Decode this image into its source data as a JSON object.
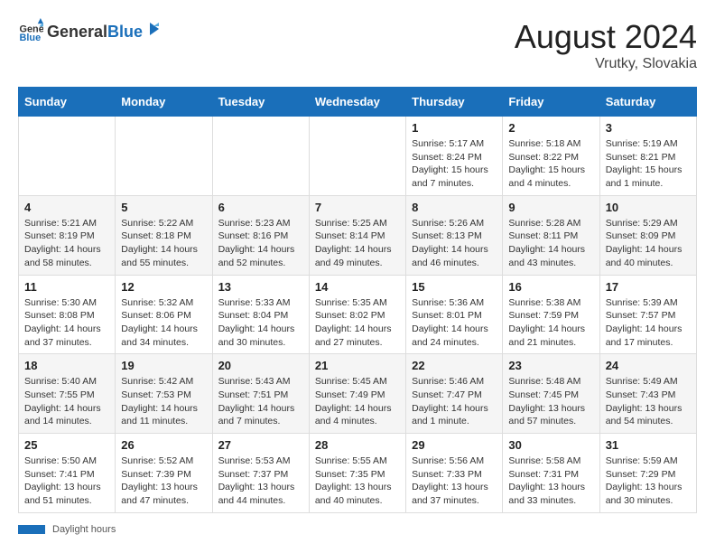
{
  "header": {
    "logo_general": "General",
    "logo_blue": "Blue",
    "month_year": "August 2024",
    "location": "Vrutky, Slovakia"
  },
  "footer": {
    "daylight_label": "Daylight hours"
  },
  "weekdays": [
    "Sunday",
    "Monday",
    "Tuesday",
    "Wednesday",
    "Thursday",
    "Friday",
    "Saturday"
  ],
  "weeks": [
    [
      {
        "day": "",
        "info": ""
      },
      {
        "day": "",
        "info": ""
      },
      {
        "day": "",
        "info": ""
      },
      {
        "day": "",
        "info": ""
      },
      {
        "day": "1",
        "info": "Sunrise: 5:17 AM\nSunset: 8:24 PM\nDaylight: 15 hours and 7 minutes."
      },
      {
        "day": "2",
        "info": "Sunrise: 5:18 AM\nSunset: 8:22 PM\nDaylight: 15 hours and 4 minutes."
      },
      {
        "day": "3",
        "info": "Sunrise: 5:19 AM\nSunset: 8:21 PM\nDaylight: 15 hours and 1 minute."
      }
    ],
    [
      {
        "day": "4",
        "info": "Sunrise: 5:21 AM\nSunset: 8:19 PM\nDaylight: 14 hours and 58 minutes."
      },
      {
        "day": "5",
        "info": "Sunrise: 5:22 AM\nSunset: 8:18 PM\nDaylight: 14 hours and 55 minutes."
      },
      {
        "day": "6",
        "info": "Sunrise: 5:23 AM\nSunset: 8:16 PM\nDaylight: 14 hours and 52 minutes."
      },
      {
        "day": "7",
        "info": "Sunrise: 5:25 AM\nSunset: 8:14 PM\nDaylight: 14 hours and 49 minutes."
      },
      {
        "day": "8",
        "info": "Sunrise: 5:26 AM\nSunset: 8:13 PM\nDaylight: 14 hours and 46 minutes."
      },
      {
        "day": "9",
        "info": "Sunrise: 5:28 AM\nSunset: 8:11 PM\nDaylight: 14 hours and 43 minutes."
      },
      {
        "day": "10",
        "info": "Sunrise: 5:29 AM\nSunset: 8:09 PM\nDaylight: 14 hours and 40 minutes."
      }
    ],
    [
      {
        "day": "11",
        "info": "Sunrise: 5:30 AM\nSunset: 8:08 PM\nDaylight: 14 hours and 37 minutes."
      },
      {
        "day": "12",
        "info": "Sunrise: 5:32 AM\nSunset: 8:06 PM\nDaylight: 14 hours and 34 minutes."
      },
      {
        "day": "13",
        "info": "Sunrise: 5:33 AM\nSunset: 8:04 PM\nDaylight: 14 hours and 30 minutes."
      },
      {
        "day": "14",
        "info": "Sunrise: 5:35 AM\nSunset: 8:02 PM\nDaylight: 14 hours and 27 minutes."
      },
      {
        "day": "15",
        "info": "Sunrise: 5:36 AM\nSunset: 8:01 PM\nDaylight: 14 hours and 24 minutes."
      },
      {
        "day": "16",
        "info": "Sunrise: 5:38 AM\nSunset: 7:59 PM\nDaylight: 14 hours and 21 minutes."
      },
      {
        "day": "17",
        "info": "Sunrise: 5:39 AM\nSunset: 7:57 PM\nDaylight: 14 hours and 17 minutes."
      }
    ],
    [
      {
        "day": "18",
        "info": "Sunrise: 5:40 AM\nSunset: 7:55 PM\nDaylight: 14 hours and 14 minutes."
      },
      {
        "day": "19",
        "info": "Sunrise: 5:42 AM\nSunset: 7:53 PM\nDaylight: 14 hours and 11 minutes."
      },
      {
        "day": "20",
        "info": "Sunrise: 5:43 AM\nSunset: 7:51 PM\nDaylight: 14 hours and 7 minutes."
      },
      {
        "day": "21",
        "info": "Sunrise: 5:45 AM\nSunset: 7:49 PM\nDaylight: 14 hours and 4 minutes."
      },
      {
        "day": "22",
        "info": "Sunrise: 5:46 AM\nSunset: 7:47 PM\nDaylight: 14 hours and 1 minute."
      },
      {
        "day": "23",
        "info": "Sunrise: 5:48 AM\nSunset: 7:45 PM\nDaylight: 13 hours and 57 minutes."
      },
      {
        "day": "24",
        "info": "Sunrise: 5:49 AM\nSunset: 7:43 PM\nDaylight: 13 hours and 54 minutes."
      }
    ],
    [
      {
        "day": "25",
        "info": "Sunrise: 5:50 AM\nSunset: 7:41 PM\nDaylight: 13 hours and 51 minutes."
      },
      {
        "day": "26",
        "info": "Sunrise: 5:52 AM\nSunset: 7:39 PM\nDaylight: 13 hours and 47 minutes."
      },
      {
        "day": "27",
        "info": "Sunrise: 5:53 AM\nSunset: 7:37 PM\nDaylight: 13 hours and 44 minutes."
      },
      {
        "day": "28",
        "info": "Sunrise: 5:55 AM\nSunset: 7:35 PM\nDaylight: 13 hours and 40 minutes."
      },
      {
        "day": "29",
        "info": "Sunrise: 5:56 AM\nSunset: 7:33 PM\nDaylight: 13 hours and 37 minutes."
      },
      {
        "day": "30",
        "info": "Sunrise: 5:58 AM\nSunset: 7:31 PM\nDaylight: 13 hours and 33 minutes."
      },
      {
        "day": "31",
        "info": "Sunrise: 5:59 AM\nSunset: 7:29 PM\nDaylight: 13 hours and 30 minutes."
      }
    ]
  ]
}
